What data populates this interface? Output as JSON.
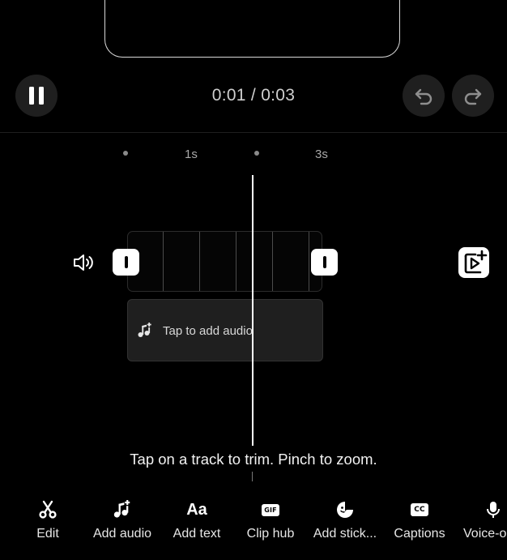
{
  "player": {
    "time_display": "0:01 / 0:03",
    "pause_icon": "pause-icon",
    "undo_icon": "undo-icon",
    "redo_icon": "redo-icon"
  },
  "ruler": {
    "labels": [
      "1s",
      "3s"
    ]
  },
  "timeline": {
    "volume_icon": "speaker-volume-icon",
    "add_clip_icon": "add-video-clip-icon",
    "audio_prompt": "Tap to add audio",
    "audio_icon": "music-note-add-icon",
    "hint": "Tap on a track to trim. Pinch to zoom."
  },
  "toolbar": {
    "items": [
      {
        "label": "Edit",
        "icon": "scissors-icon"
      },
      {
        "label": "Add audio",
        "icon": "music-note-add-icon"
      },
      {
        "label": "Add text",
        "icon": "text-aa-icon",
        "glyph": "Aa"
      },
      {
        "label": "Clip hub",
        "icon": "gif-icon",
        "glyph": "GIF"
      },
      {
        "label": "Add stick...",
        "icon": "sticker-icon"
      },
      {
        "label": "Captions",
        "icon": "cc-icon",
        "glyph": "CC"
      },
      {
        "label": "Voice-o",
        "icon": "microphone-icon"
      }
    ]
  },
  "colors": {
    "background": "#000000",
    "button_bg": "#1f1f1f",
    "audio_track_bg": "#1f1f1f",
    "text": "#ffffff"
  }
}
